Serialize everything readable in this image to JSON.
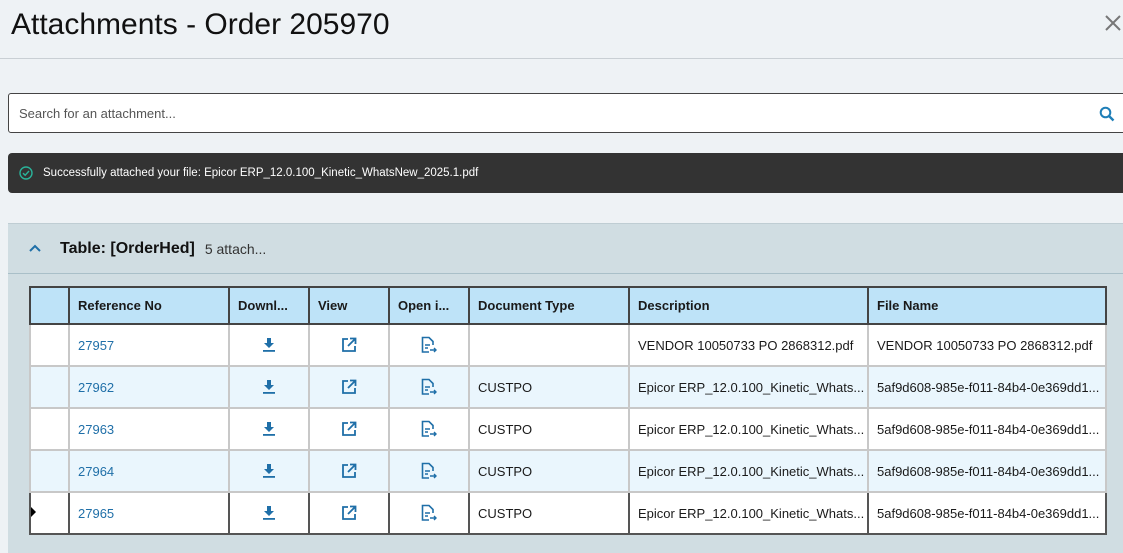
{
  "header": {
    "title": "Attachments - Order 205970"
  },
  "search": {
    "placeholder": "Search for an attachment..."
  },
  "toast": {
    "message": "Successfully attached your file: Epicor ERP_12.0.100_Kinetic_WhatsNew_2025.1.pdf"
  },
  "panel": {
    "title": "Table: [OrderHed]",
    "count": "5 attach..."
  },
  "table": {
    "columns": [
      "",
      "Reference No",
      "Downl...",
      "View",
      "Open i...",
      "Document Type",
      "Description",
      "File Name"
    ],
    "rows": [
      {
        "ref": "27957",
        "doc_type": "",
        "description": "VENDOR 10050733 PO 2868312.pdf",
        "file_name": "VENDOR 10050733 PO 2868312.pdf"
      },
      {
        "ref": "27962",
        "doc_type": "CUSTPO",
        "description": "Epicor ERP_12.0.100_Kinetic_Whats...",
        "file_name": "5af9d608-985e-f011-84b4-0e369dd1..."
      },
      {
        "ref": "27963",
        "doc_type": "CUSTPO",
        "description": "Epicor ERP_12.0.100_Kinetic_Whats...",
        "file_name": "5af9d608-985e-f011-84b4-0e369dd1..."
      },
      {
        "ref": "27964",
        "doc_type": "CUSTPO",
        "description": "Epicor ERP_12.0.100_Kinetic_Whats...",
        "file_name": "5af9d608-985e-f011-84b4-0e369dd1..."
      },
      {
        "ref": "27965",
        "doc_type": "CUSTPO",
        "description": "Epicor ERP_12.0.100_Kinetic_Whats...",
        "file_name": "5af9d608-985e-f011-84b4-0e369dd1..."
      }
    ]
  },
  "colors": {
    "accent": "#1f6fa8",
    "header_bg": "#bee3f8",
    "alt_row": "#eaf6fd",
    "toast_bg": "#333333",
    "success": "#2ab39a"
  }
}
